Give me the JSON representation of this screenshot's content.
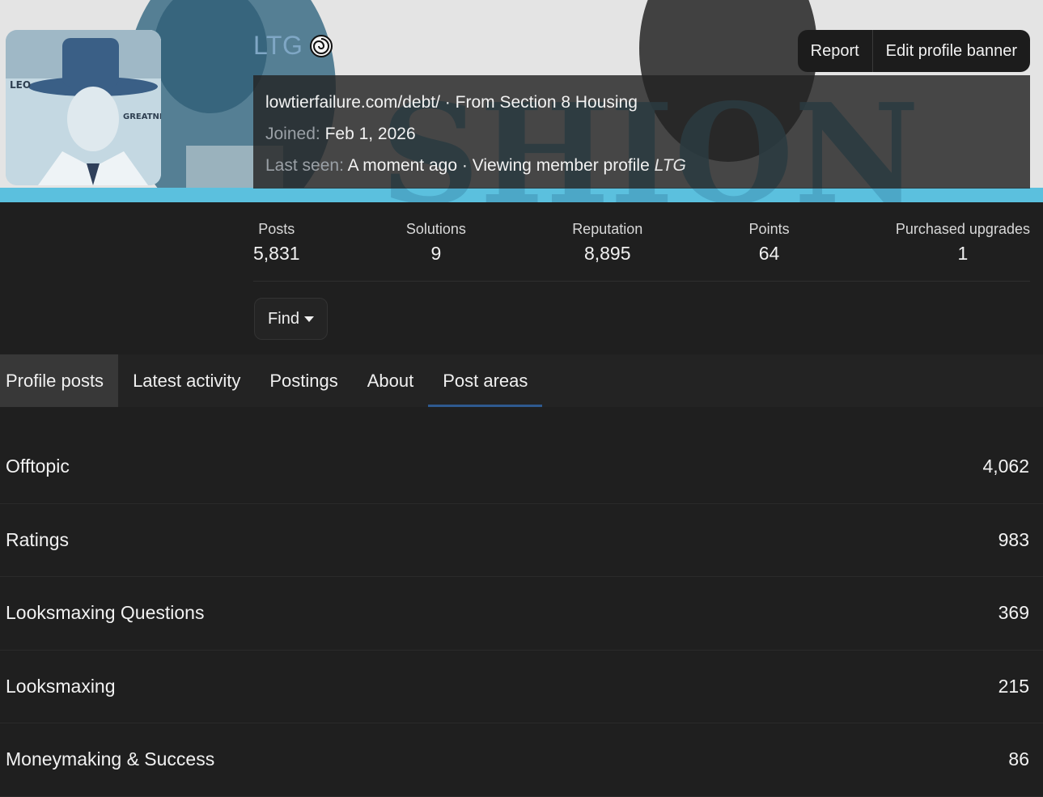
{
  "profile": {
    "username": "LTG",
    "badge_icon": "spiral-badge-icon",
    "custom_title": "lowtierfailure.com/debt/",
    "location_prefix": "From",
    "location": "Section 8 Housing",
    "joined_label": "Joined:",
    "joined_value": "Feb 1, 2026",
    "last_seen_label": "Last seen:",
    "last_seen_value": "A moment ago",
    "activity_text": "Viewing member profile",
    "activity_target": "LTG",
    "separator": "·",
    "username_color": "#7fa7c5"
  },
  "actions": {
    "report_label": "Report",
    "edit_banner_label": "Edit profile banner"
  },
  "stats": [
    {
      "label": "Posts",
      "value": "5,831"
    },
    {
      "label": "Solutions",
      "value": "9"
    },
    {
      "label": "Reputation",
      "value": "8,895"
    },
    {
      "label": "Points",
      "value": "64"
    },
    {
      "label": "Purchased upgrades",
      "value": "1"
    }
  ],
  "find_button": {
    "label": "Find"
  },
  "tabs": [
    {
      "label": "Profile posts"
    },
    {
      "label": "Latest activity"
    },
    {
      "label": "Postings"
    },
    {
      "label": "About"
    },
    {
      "label": "Post areas"
    }
  ],
  "post_areas": [
    {
      "name": "Offtopic",
      "count": "4,062"
    },
    {
      "name": "Ratings",
      "count": "983"
    },
    {
      "name": "Looksmaxing Questions",
      "count": "369"
    },
    {
      "name": "Looksmaxing",
      "count": "215"
    },
    {
      "name": "Moneymaking & Success",
      "count": "86"
    }
  ],
  "colors": {
    "background": "#1f1f1f",
    "tab_active_underline": "#2e5a8f",
    "banner_accent": "#5bc0de"
  }
}
